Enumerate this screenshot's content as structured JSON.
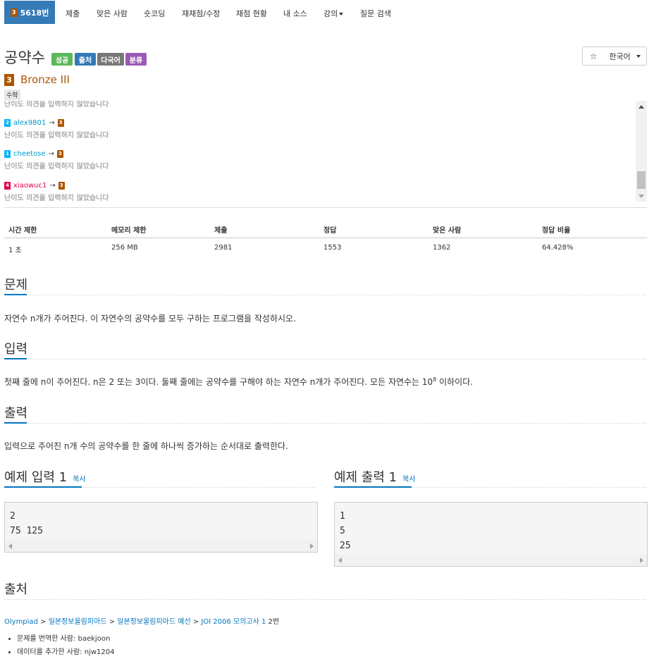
{
  "nav": {
    "active_tier": "3",
    "active_label": "5618번",
    "items": [
      "제출",
      "맞은 사람",
      "숏코딩",
      "재채점/수정",
      "채점 현황",
      "내 소스",
      "강의",
      "질문 검색"
    ]
  },
  "problem": {
    "title": "공약수",
    "labels": [
      {
        "text": "성공",
        "color": "#5cb85c"
      },
      {
        "text": "출처",
        "color": "#337ab7"
      },
      {
        "text": "다국어",
        "color": "#777777"
      },
      {
        "text": "분류",
        "color": "#9b59b6"
      }
    ],
    "star_icon": "☆",
    "language": "한국어",
    "tier_badge": "3",
    "tier_name": "Bronze III",
    "tag": "수학"
  },
  "opinions": {
    "partial_text": "난이도 의견을 입력하지 않았습니다",
    "items": [
      {
        "from_tier": "2",
        "from_color": "#00b4fc",
        "user": "alex9801",
        "user_color": "#0099cc",
        "arrow": "→",
        "to_tier": "3",
        "note": "난이도 의견을 입력하지 않았습니다"
      },
      {
        "from_tier": "1",
        "from_color": "#00b4fc",
        "user": "cheetose",
        "user_color": "#0099cc",
        "arrow": "→",
        "to_tier": "3",
        "note": "난이도 의견을 입력하지 않았습니다"
      },
      {
        "from_tier": "4",
        "from_color": "#e0004c",
        "user": "xiaowuc1",
        "user_color": "#e0004c",
        "arrow": "→",
        "to_tier": "3",
        "note": "난이도 의견을 입력하지 않았습니다"
      }
    ]
  },
  "stats": {
    "headers": [
      "시간 제한",
      "메모리 제한",
      "제출",
      "정답",
      "맞은 사람",
      "정답 비율"
    ],
    "values": [
      "1 초",
      "256 MB",
      "2981",
      "1553",
      "1362",
      "64.428%"
    ]
  },
  "sections": {
    "problem_heading": "문제",
    "problem_text": "자연수 n개가 주어진다. 이 자연수의 공약수를 모두 구하는 프로그램을 작성하시오.",
    "input_heading": "입력",
    "input_text_a": "첫째 줄에 n이 주어진다. n은 2 또는 3이다. 둘째 줄에는 공약수를 구해야 하는 자연수 n개가 주어진다. 모든 자연수는 10",
    "input_sup": "8",
    "input_text_b": " 이하이다.",
    "output_heading": "출력",
    "output_text": "입력으로 주어진 n개 수의 공약수를 한 줄에 하나씩 증가하는 순서대로 출력한다."
  },
  "samples": {
    "input_heading": "예제 입력 1",
    "output_heading": "예제 출력 1",
    "copy_label": "복사",
    "input_text": "2\n75 125",
    "output_text": "1\n5\n25"
  },
  "source": {
    "heading": "출처",
    "path": [
      "Olympiad",
      "일본정보올림피아드",
      "일본정보올림피아드 예선",
      "JOI 2006 모의고사 1"
    ],
    "separator": ">",
    "suffix": "2번",
    "credits": [
      "문제를 번역한 사람: baekjoon",
      "데이터를 추가한 사람: njw1204"
    ]
  },
  "colors": {
    "accent": "#0076c0",
    "nav_active": "#337ab7",
    "bronze": "#ad5600"
  }
}
